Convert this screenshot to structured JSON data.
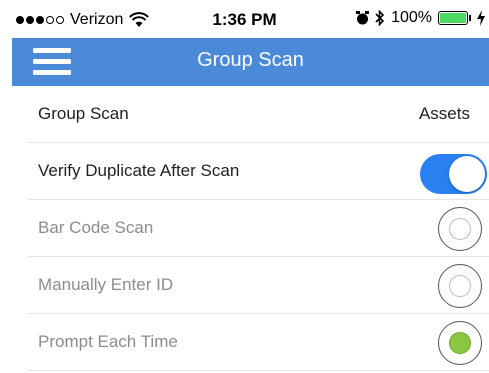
{
  "status_bar": {
    "carrier": "Verizon",
    "time": "1:36 PM",
    "battery_percent": "100%",
    "battery_level": 1.0,
    "signal_strength": "3 of 5",
    "icons": [
      "signal-dots-icon",
      "wifi-icon",
      "alarm-icon",
      "bluetooth-icon",
      "battery-icon",
      "charging-icon"
    ]
  },
  "nav": {
    "title": "Group Scan",
    "menu_icon": "hamburger-menu-icon",
    "color": "#4a8ad9"
  },
  "rows": [
    {
      "label": "Group Scan",
      "value": "Assets",
      "type": "value"
    },
    {
      "label": "Verify Duplicate After Scan",
      "type": "toggle",
      "checked": true
    },
    {
      "label": "Bar Code Scan",
      "type": "radio",
      "selected": false
    },
    {
      "label": "Manually Enter ID",
      "type": "radio",
      "selected": false
    },
    {
      "label": "Prompt Each Time",
      "type": "radio",
      "selected": true
    }
  ],
  "colors": {
    "toggle_on": "#2a80f0",
    "radio_selected": "#8ac640"
  }
}
